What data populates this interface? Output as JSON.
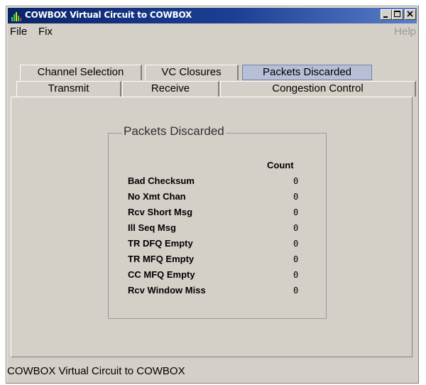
{
  "window": {
    "title": "COWBOX Virtual Circuit to COWBOX",
    "icon": "bar-chart-icon",
    "controls": {
      "minimize": "minimize-icon",
      "maximize": "maximize-icon",
      "close": "close-icon"
    }
  },
  "menu": {
    "file": "File",
    "fix": "Fix",
    "help": "Help"
  },
  "tabs": {
    "channel_selection": "Channel Selection",
    "vc_closures": "VC Closures",
    "packets_discarded": "Packets Discarded",
    "transmit": "Transmit",
    "receive": "Receive",
    "congestion_control": "Congestion Control",
    "selected": "Packets Discarded"
  },
  "panel": {
    "group_title": "Packets Discarded",
    "count_header": "Count",
    "rows": [
      {
        "label": "Bad Checksum",
        "value": "0"
      },
      {
        "label": "No Xmt Chan",
        "value": "0"
      },
      {
        "label": "Rcv Short Msg",
        "value": "0"
      },
      {
        "label": "Ill Seq Msg",
        "value": "0"
      },
      {
        "label": "TR DFQ Empty",
        "value": "0"
      },
      {
        "label": "TR MFQ Empty",
        "value": "0"
      },
      {
        "label": "CC MFQ Empty",
        "value": "0"
      },
      {
        "label": "Rcv Window Miss",
        "value": "0"
      }
    ]
  },
  "status": "COWBOX Virtual Circuit to COWBOX",
  "colors": {
    "title_bar": "#0a246a",
    "selected_tab": "#b6bfd6",
    "window_bg": "#d4d0c8"
  }
}
